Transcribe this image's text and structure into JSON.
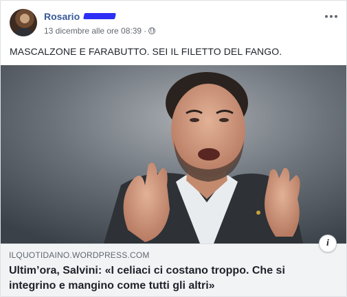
{
  "post": {
    "author": "Rosario",
    "timestamp": "13 dicembre alle ore 08:39",
    "separator": "·",
    "privacy_icon": "globe-icon",
    "more_icon": "more-horizontal-icon",
    "text": "MASCALZONE E FARABUTTO. SEI IL FILETTO DEL FANGO."
  },
  "link": {
    "domain": "ILQUOTIDAINO.WORDPRESS.COM",
    "title": "Ultim’ora, Salvini: «I celiaci ci costano troppo. Che si integrino e mangino come tutti gli altri»",
    "info_label": "i"
  },
  "colors": {
    "author_link": "#365899",
    "redaction": "#2d2ff5",
    "caption_bg": "#f2f3f5"
  }
}
